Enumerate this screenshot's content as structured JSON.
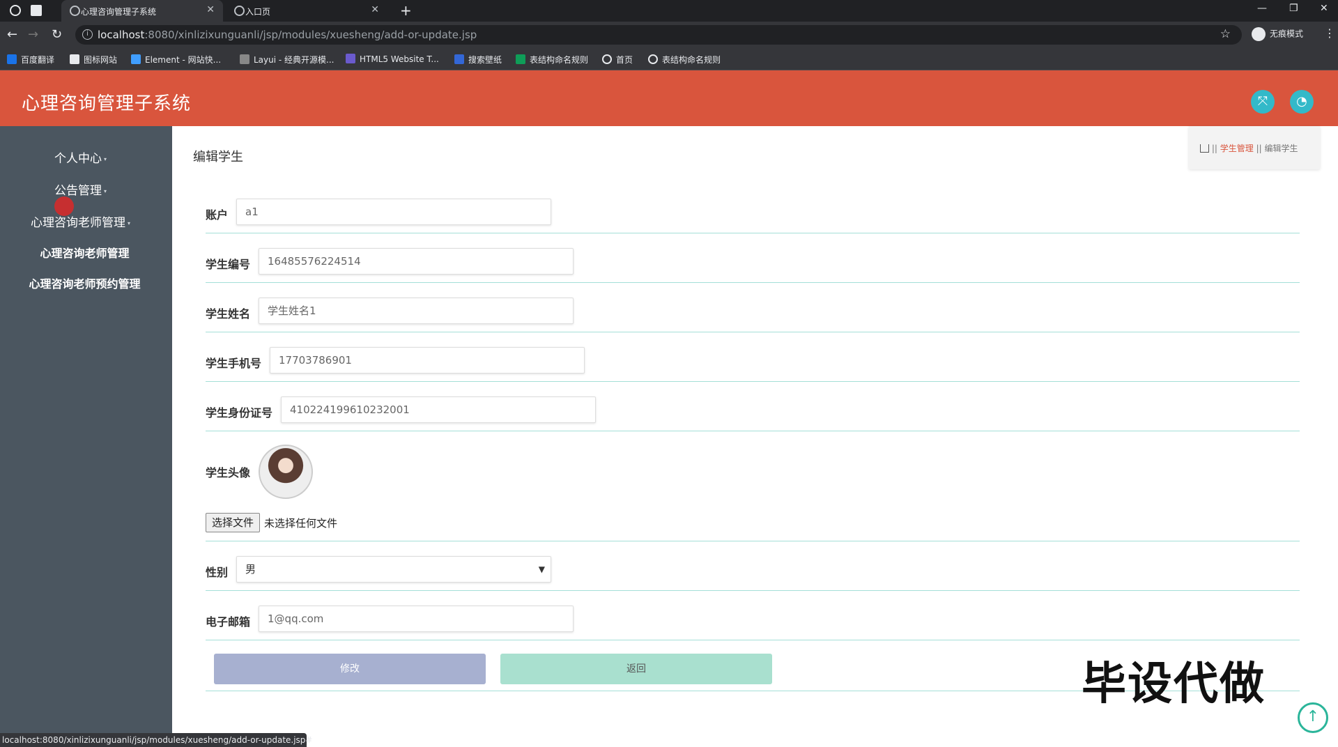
{
  "browser": {
    "tabs": [
      {
        "title": "心理咨询管理子系统",
        "active": true
      },
      {
        "title": "入口页",
        "active": false
      }
    ],
    "url_host": "localhost",
    "url_path": ":8080/xinlizixunguanli/jsp/modules/xuesheng/add-or-update.jsp",
    "incognito_label": "无痕模式",
    "bookmarks": [
      "百度翻译",
      "图标网站",
      "Element - 网站快...",
      "Layui - 经典开源模...",
      "HTML5 Website T...",
      "搜索壁纸",
      "表结构命名规则",
      "首页",
      "表结构命名规则"
    ],
    "status_url": "localhost:8080/xinlizixunguanli/jsp/modules/xuesheng/add-or-update.jsp#"
  },
  "app": {
    "title": "心理咨询管理子系统"
  },
  "sidebar": {
    "items": [
      {
        "label": "个人中心"
      },
      {
        "label": "公告管理"
      },
      {
        "label": "心理咨询老师管理"
      },
      {
        "label": "心理咨询老师管理"
      },
      {
        "label": "心理咨询老师预约管理"
      }
    ]
  },
  "main": {
    "title": "编辑学生",
    "breadcrumb": {
      "link": "学生管理",
      "current": "编辑学生"
    },
    "form": {
      "account": {
        "label": "账户",
        "value": "a1"
      },
      "student_no": {
        "label": "学生编号",
        "value": "16485576224514"
      },
      "student_name": {
        "label": "学生姓名",
        "value": "学生姓名1"
      },
      "phone": {
        "label": "学生手机号",
        "value": "17703786901"
      },
      "id_card": {
        "label": "学生身份证号",
        "value": "410224199610232001"
      },
      "avatar": {
        "label": "学生头像",
        "file_button": "选择文件",
        "file_status": "未选择任何文件"
      },
      "gender": {
        "label": "性别",
        "value": "男"
      },
      "email": {
        "label": "电子邮箱",
        "value": "1@qq.com"
      }
    },
    "buttons": {
      "submit": "修改",
      "back": "返回"
    },
    "watermark": "毕设代做"
  },
  "colors": {
    "header": "#d9553d",
    "sidebar": "#4b5660",
    "accent": "#33b9c9",
    "submit": "#a7b0d0",
    "back": "#a9e0cf",
    "divider": "#a4dfd7"
  }
}
